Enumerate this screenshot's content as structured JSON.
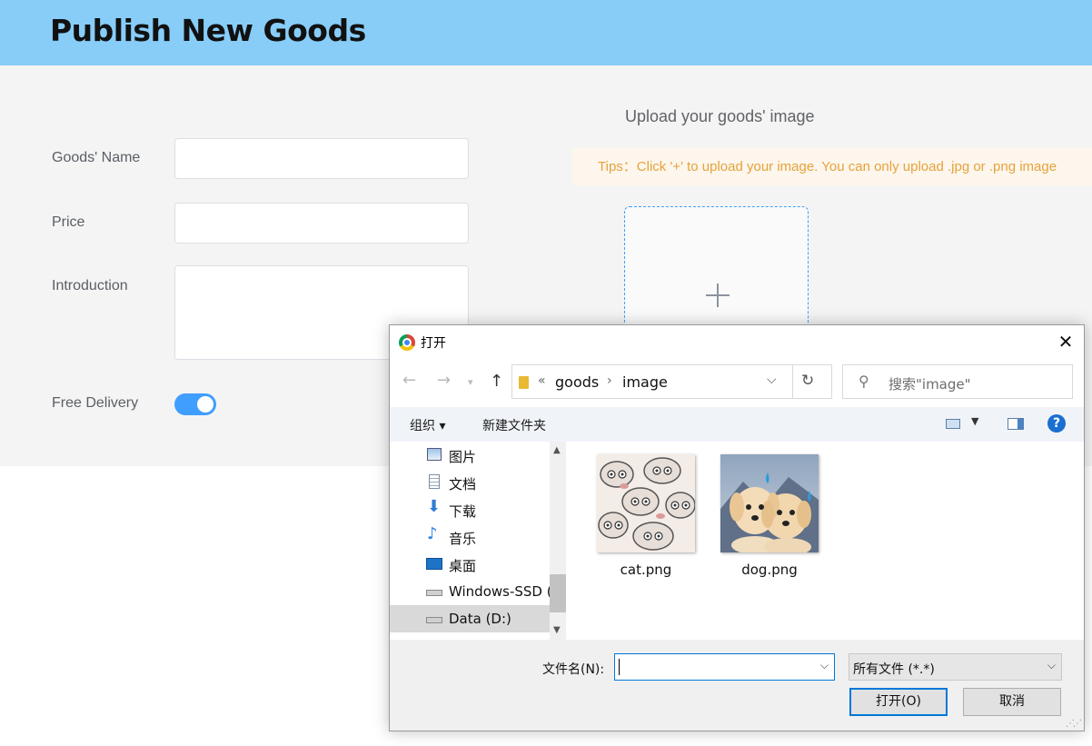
{
  "page": {
    "title": "Publish New Goods",
    "form": {
      "name_label": "Goods' Name",
      "price_label": "Price",
      "intro_label": "Introduction",
      "delivery_label": "Free Delivery",
      "name_value": "",
      "price_value": "",
      "intro_value": "",
      "free_delivery_on": true
    },
    "upload": {
      "title": "Upload your goods' image",
      "tips": "Tips：Click '+' to upload your image. You can only upload .jpg or .png image"
    },
    "colors": {
      "header": "#87cdf8",
      "accent": "#409eff",
      "tips_text": "#e6a23c"
    }
  },
  "dialog": {
    "title": "打开",
    "close_icon": "close-icon",
    "address": {
      "overflow": "«",
      "crumbs": [
        "goods",
        "image"
      ]
    },
    "search_placeholder": "搜索\"image\"",
    "toolbar": {
      "organize": "组织 ▾",
      "new_folder": "新建文件夹",
      "help": "?"
    },
    "nav_items": [
      {
        "label": "图片",
        "icon": "pictures-icon"
      },
      {
        "label": "文档",
        "icon": "documents-icon"
      },
      {
        "label": "下载",
        "icon": "downloads-icon"
      },
      {
        "label": "音乐",
        "icon": "music-icon"
      },
      {
        "label": "桌面",
        "icon": "desktop-icon"
      },
      {
        "label": "Windows-SSD (",
        "icon": "drive-icon"
      },
      {
        "label": "Data (D:)",
        "icon": "drive-icon",
        "selected": true
      }
    ],
    "files": [
      {
        "name": "cat.png"
      },
      {
        "name": "dog.png"
      }
    ],
    "filename_label": "文件名(N):",
    "filename_value": "",
    "filter_value": "所有文件 (*.*)",
    "open_button": "打开(O)",
    "cancel_button": "取消"
  }
}
